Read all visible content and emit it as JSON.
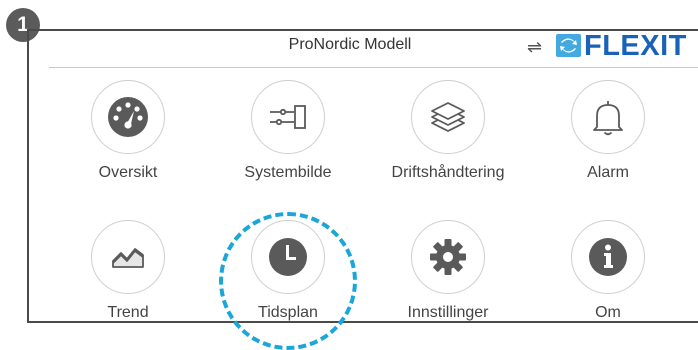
{
  "step_badge": "1",
  "header": {
    "title": "ProNordic Modell",
    "connection_symbol": "⇌",
    "brand": "FLEXIT"
  },
  "menu": {
    "items": [
      {
        "label": "Oversikt",
        "icon": "speedometer-icon"
      },
      {
        "label": "Systembilde",
        "icon": "system-diagram-icon"
      },
      {
        "label": "Driftshåndtering",
        "icon": "layers-icon"
      },
      {
        "label": "Alarm",
        "icon": "bell-icon"
      },
      {
        "label": "Trend",
        "icon": "trend-chart-icon"
      },
      {
        "label": "Tidsplan",
        "icon": "clock-icon"
      },
      {
        "label": "Innstillinger",
        "icon": "gear-icon"
      },
      {
        "label": "Om",
        "icon": "info-icon"
      }
    ],
    "highlighted_item": "Tidsplan"
  },
  "colors": {
    "icon_fill": "#5a5a5a",
    "highlight": "#1aa6d8",
    "brand": "#1a62b8",
    "brand_icon": "#44a9e0"
  }
}
